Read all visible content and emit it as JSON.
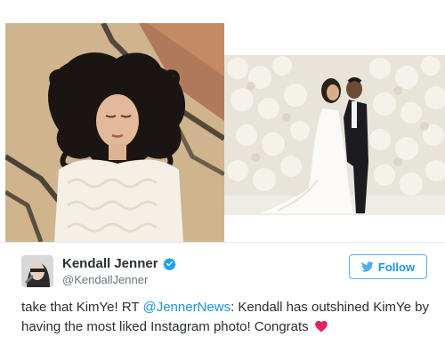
{
  "tweet": {
    "display_name": "Kendall Jenner",
    "handle": "@KendallJenner",
    "follow_label": "Follow",
    "text_part1": "take that KimYe! RT ",
    "mention": "@JennerNews",
    "text_part2": ": Kendall has outshined KimYe by having the most liked Instagram photo! Congrats",
    "heart_icon": "heart-icon",
    "verified_icon": "verified-badge-icon"
  },
  "colors": {
    "accent": "#1b95e0",
    "follow_border": "#55acee",
    "name": "#292f33",
    "handle": "#66757f",
    "heart": "#e0245e",
    "verified": "#1da1f2"
  },
  "photos": {
    "left": "photo-kendall-lying-with-hair-spread",
    "right": "photo-couple-kissing-flower-wall"
  }
}
